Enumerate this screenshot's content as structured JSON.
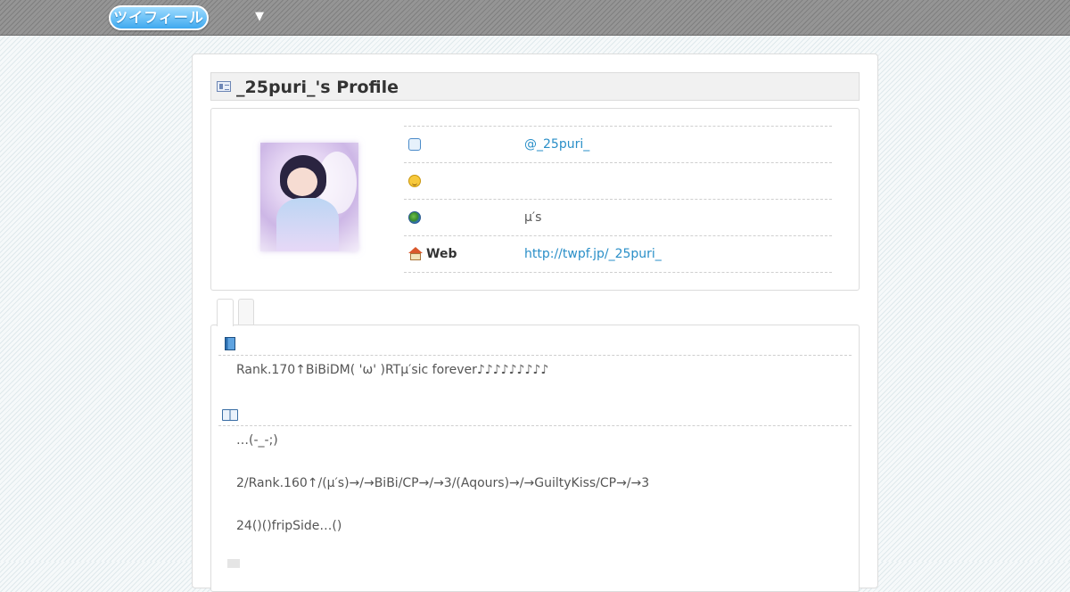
{
  "header": {
    "logo_text": "ツイフィール",
    "menu_toggle": "▼"
  },
  "profile": {
    "title": "_25puri_'s Profile",
    "rows": [
      {
        "icon": "speech-bubble-icon",
        "label": "",
        "value": "@_25puri_"
      },
      {
        "icon": "smiley-icon",
        "label": "",
        "value": ""
      },
      {
        "icon": "globe-icon",
        "label": "",
        "value": "μ′s"
      },
      {
        "icon": "house-icon",
        "label": "Web",
        "value": "http://twpf.jp/_25puri_"
      }
    ]
  },
  "tabs": [
    "",
    ""
  ],
  "content": {
    "sections": [
      {
        "icon": "notebook-icon",
        "lines": [
          "Rank.170↑BiBiDM( 'ω' )RTμ′sic forever♪♪♪♪♪♪♪♪♪"
        ]
      },
      {
        "icon": "open-book-icon",
        "lines": [
          "…(-_-;)",
          "2/Rank.160↑/(μ′s)→/→BiBi/CP→/→3/(Aqours)→/→GuiltyKiss/CP→/→3",
          "24()()fripSide…()"
        ]
      }
    ]
  },
  "colors": {
    "link": "#2a8fc8",
    "logo": "#3fa9ef"
  }
}
